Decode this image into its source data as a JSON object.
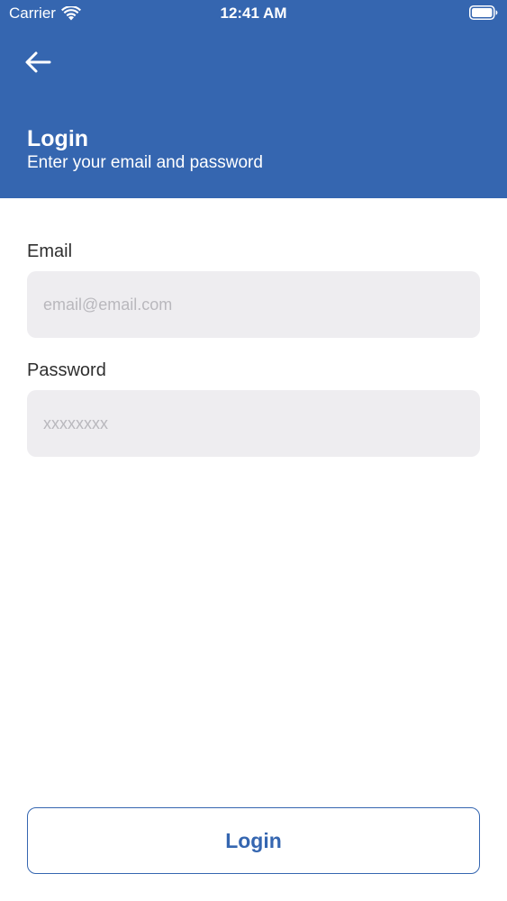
{
  "status_bar": {
    "carrier": "Carrier",
    "time": "12:41 AM",
    "icons": [
      "wifi-icon",
      "battery-icon"
    ]
  },
  "header": {
    "back_icon": "arrow-left-icon",
    "title": "Login",
    "subtitle": "Enter your email and password",
    "background_color": "#3566b0"
  },
  "form": {
    "email": {
      "label": "Email",
      "value": "",
      "placeholder": "email@email.com"
    },
    "password": {
      "label": "Password",
      "value": "",
      "placeholder": "xxxxxxxx"
    }
  },
  "actions": {
    "login_label": "Login",
    "accent_color": "#3566b0"
  }
}
